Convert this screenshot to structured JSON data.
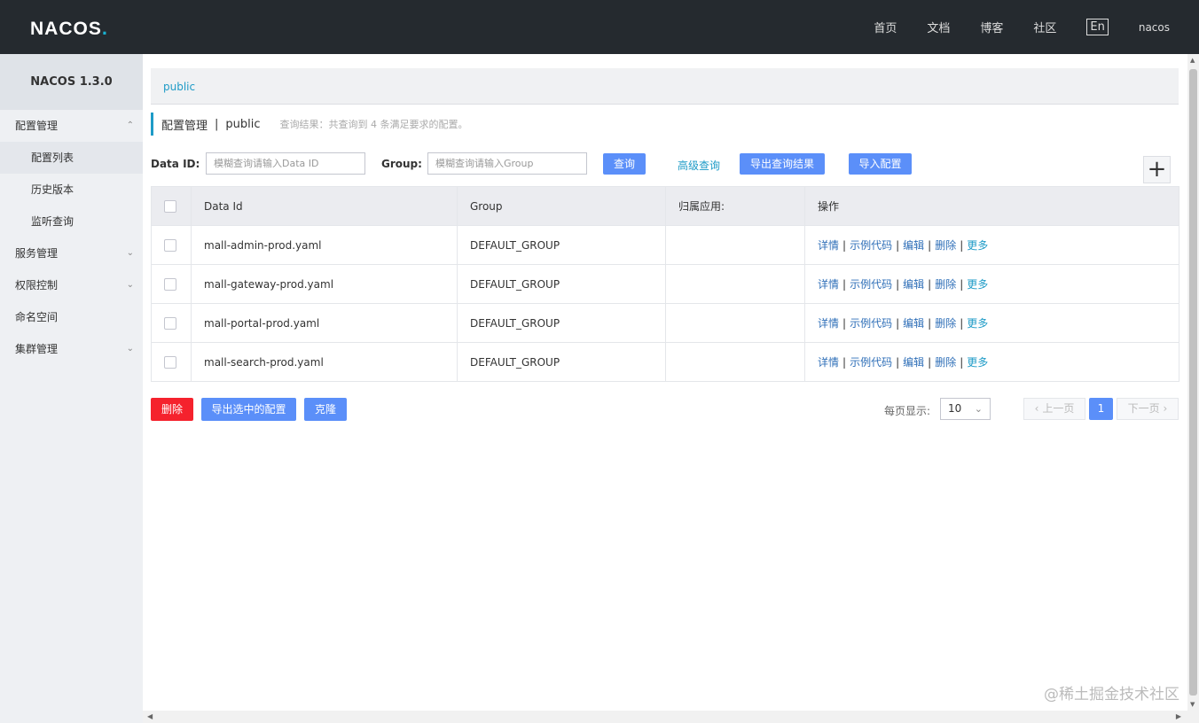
{
  "header": {
    "logo": "NACOS",
    "logo_dot": ".",
    "nav": [
      "首页",
      "文档",
      "博客",
      "社区"
    ],
    "lang": "En",
    "user": "nacos"
  },
  "sidebar": {
    "version": "NACOS 1.3.0",
    "groups": [
      {
        "label": "配置管理",
        "expanded": true,
        "subitems": [
          "配置列表",
          "历史版本",
          "监听查询"
        ]
      },
      {
        "label": "服务管理"
      },
      {
        "label": "权限控制"
      },
      {
        "label": "命名空间"
      },
      {
        "label": "集群管理"
      }
    ]
  },
  "namespace_bar": {
    "link": "public"
  },
  "page_title": {
    "title": "配置管理",
    "separator": "|",
    "namespace": "public",
    "summary": "查询结果：共查询到 4 条满足要求的配置。"
  },
  "filters": {
    "data_id_label": "Data ID:",
    "data_id_placeholder": "模糊查询请输入Data ID",
    "group_label": "Group:",
    "group_placeholder": "模糊查询请输入Group",
    "search_button": "查询",
    "advanced_search": "高级查询",
    "export_results": "导出查询结果",
    "import_config": "导入配置",
    "add_icon": "plus-icon"
  },
  "table": {
    "headers": [
      "Data Id",
      "Group",
      "归属应用:",
      "操作"
    ],
    "rows": [
      {
        "data_id": "mall-admin-prod.yaml",
        "group": "DEFAULT_GROUP",
        "app": ""
      },
      {
        "data_id": "mall-gateway-prod.yaml",
        "group": "DEFAULT_GROUP",
        "app": ""
      },
      {
        "data_id": "mall-portal-prod.yaml",
        "group": "DEFAULT_GROUP",
        "app": ""
      },
      {
        "data_id": "mall-search-prod.yaml",
        "group": "DEFAULT_GROUP",
        "app": ""
      }
    ],
    "ops": {
      "detail": "详情",
      "sample_code": "示例代码",
      "edit": "编辑",
      "delete": "删除",
      "more": "更多",
      "sep": "|"
    }
  },
  "bulk_actions": {
    "delete": "删除",
    "export_selected": "导出选中的配置",
    "clone": "克隆"
  },
  "pagination": {
    "page_size_label": "每页显示:",
    "page_size": "10",
    "prev": "上一页",
    "next": "下一页",
    "current_page": "1"
  },
  "watermark": "@稀土掘金技术社区",
  "colors": {
    "topbar": "#252a2f",
    "primary": "#5b8ff9",
    "danger": "#f5222d",
    "link": "#1e9bc7"
  }
}
